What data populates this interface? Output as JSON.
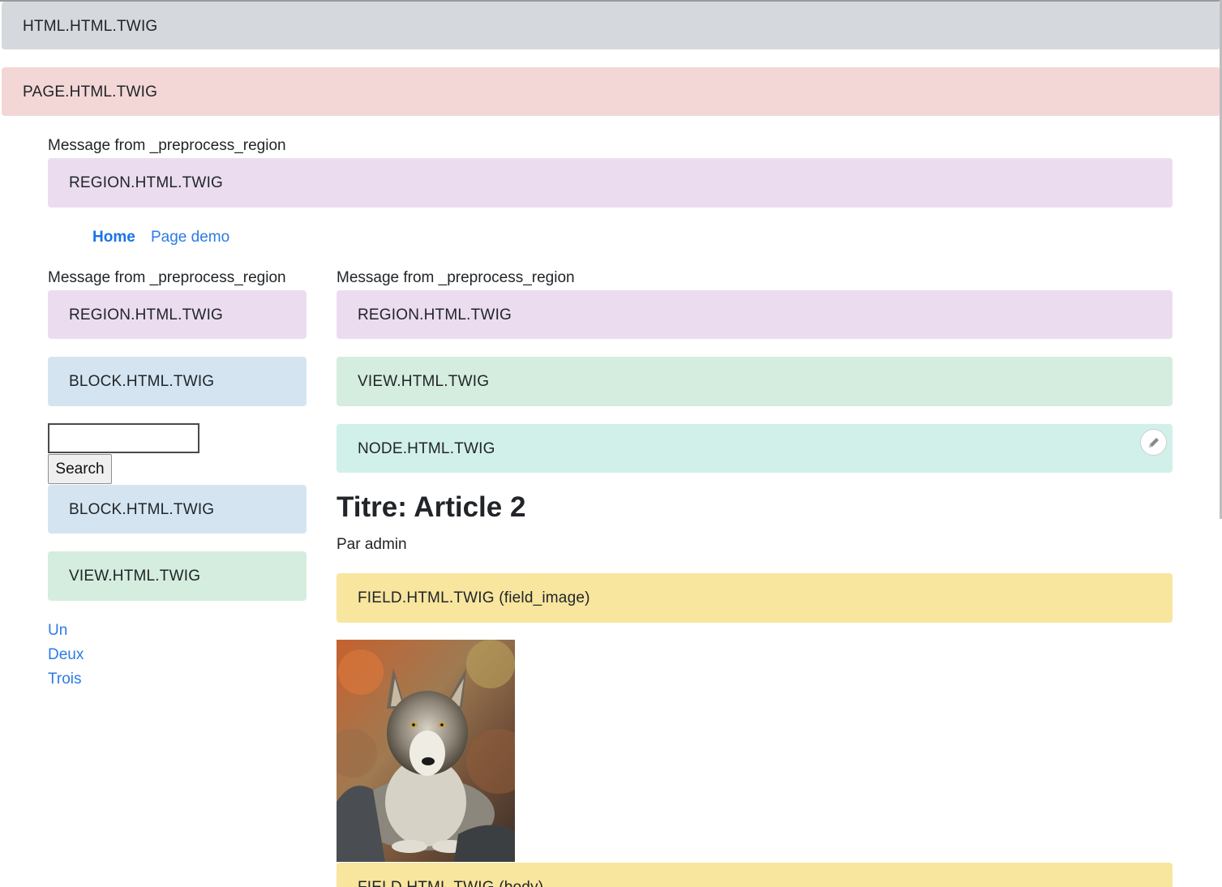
{
  "blocks": {
    "html": "HTML.HTML.TWIG",
    "page": "PAGE.HTML.TWIG",
    "region_top": "REGION.HTML.TWIG",
    "region_left": "REGION.HTML.TWIG",
    "block_left_1": "BLOCK.HTML.TWIG",
    "block_left_2": "BLOCK.HTML.TWIG",
    "view_left": "VIEW.HTML.TWIG",
    "region_main": "REGION.HTML.TWIG",
    "view_main": "VIEW.HTML.TWIG",
    "node_main": "NODE.HTML.TWIG",
    "field_image": "FIELD.HTML.TWIG (field_image)",
    "field_body": "FIELD.HTML.TWIG (body)"
  },
  "messages": {
    "top": "Message from _preprocess_region",
    "left": "Message from _preprocess_region",
    "main": "Message from _preprocess_region"
  },
  "nav": {
    "home": "Home",
    "page_demo": "Page demo"
  },
  "search": {
    "value": "",
    "button": "Search"
  },
  "article": {
    "title": "Titre: Article 2",
    "byline": "Par admin"
  },
  "sidebar_links": [
    "Un",
    "Deux",
    "Trois"
  ],
  "icons": {
    "edit": "pencil-icon"
  }
}
